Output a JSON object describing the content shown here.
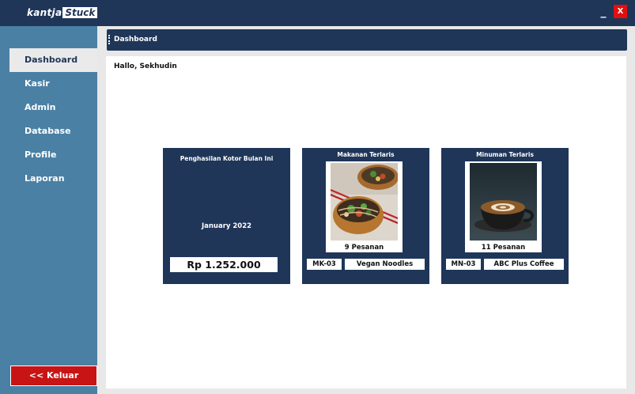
{
  "app": {
    "logo_part1": "kantja",
    "logo_part2": "Stuck",
    "minimize_label": "_",
    "close_label": "X"
  },
  "sidebar": {
    "items": [
      {
        "label": "Dashboard",
        "active": true
      },
      {
        "label": "Kasir",
        "active": false
      },
      {
        "label": "Admin",
        "active": false
      },
      {
        "label": "Database",
        "active": false
      },
      {
        "label": "Profile",
        "active": false
      },
      {
        "label": "Laporan",
        "active": false
      }
    ],
    "logout_label": "<< Keluar"
  },
  "header": {
    "title": "Dashboard"
  },
  "main": {
    "greeting": "Hallo, Sekhudin",
    "income_card": {
      "title": "Penghasilan Kotor Bulan Ini",
      "month": "January 2022",
      "amount": "Rp 1.252.000"
    },
    "food_card": {
      "title": "Makanan Terlaris",
      "orders": "9 Pesanan",
      "code": "MK-03",
      "name": "Vegan Noodles"
    },
    "drink_card": {
      "title": "Minuman Terlaris",
      "orders": "11 Pesanan",
      "code": "MN-03",
      "name": "ABC Plus Coffee"
    }
  },
  "colors": {
    "titlebar": "#1f3659",
    "sidebar": "#4a80a4",
    "card": "#1f3659",
    "logout": "#c81414",
    "close": "#e01010"
  }
}
